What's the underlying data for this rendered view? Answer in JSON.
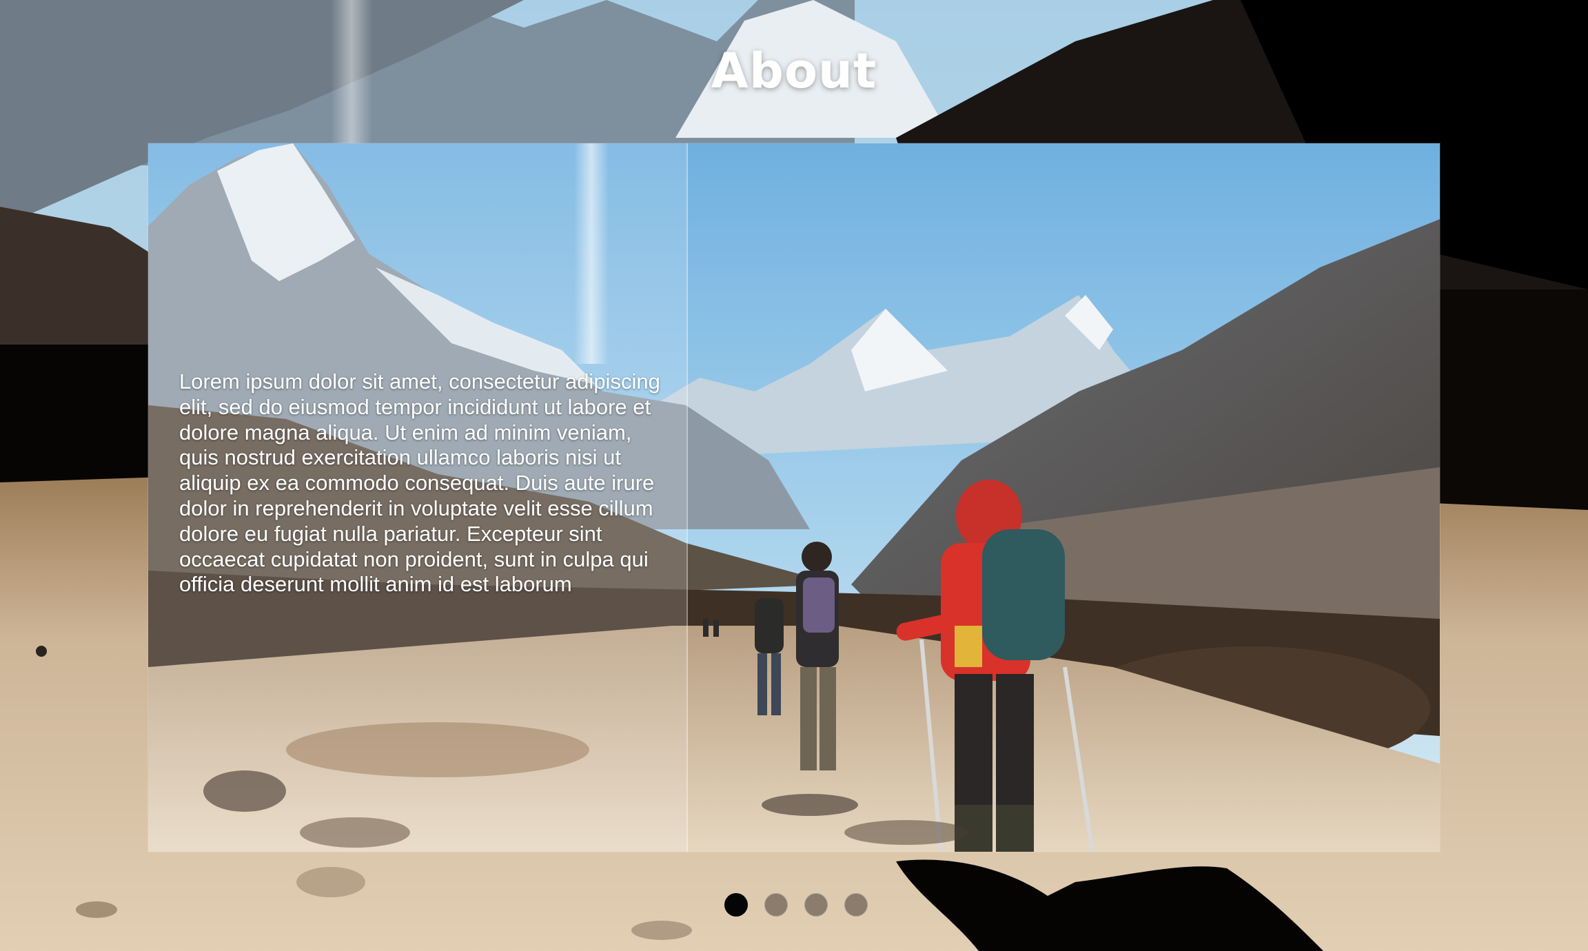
{
  "page": {
    "title": "About"
  },
  "about": {
    "body_text": "Lorem ipsum dolor sit amet, consectetur adipiscing elit, sed do eiusmod tempor incididunt ut labore et dolore magna aliqua. Ut enim ad minim veniam, quis nostrud exercitation ullamco laboris nisi ut aliquip ex ea commodo consequat. Duis aute irure dolor in reprehenderit in voluptate velit esse cillum dolore eu fugiat nulla pariatur. Excepteur sint occaecat cupidatat non proident, sunt in culpa qui officia deserunt mollit anim id est laborum"
  },
  "carousel": {
    "slide_count": 4,
    "active_index": 0
  },
  "colors": {
    "sky": "#8ec3e6",
    "trail": "#d9c7a8",
    "jacket": "#d8322a",
    "backpack": "#2f5a5e",
    "dot_active": "#050505",
    "dot_inactive": "#4a3f39"
  }
}
